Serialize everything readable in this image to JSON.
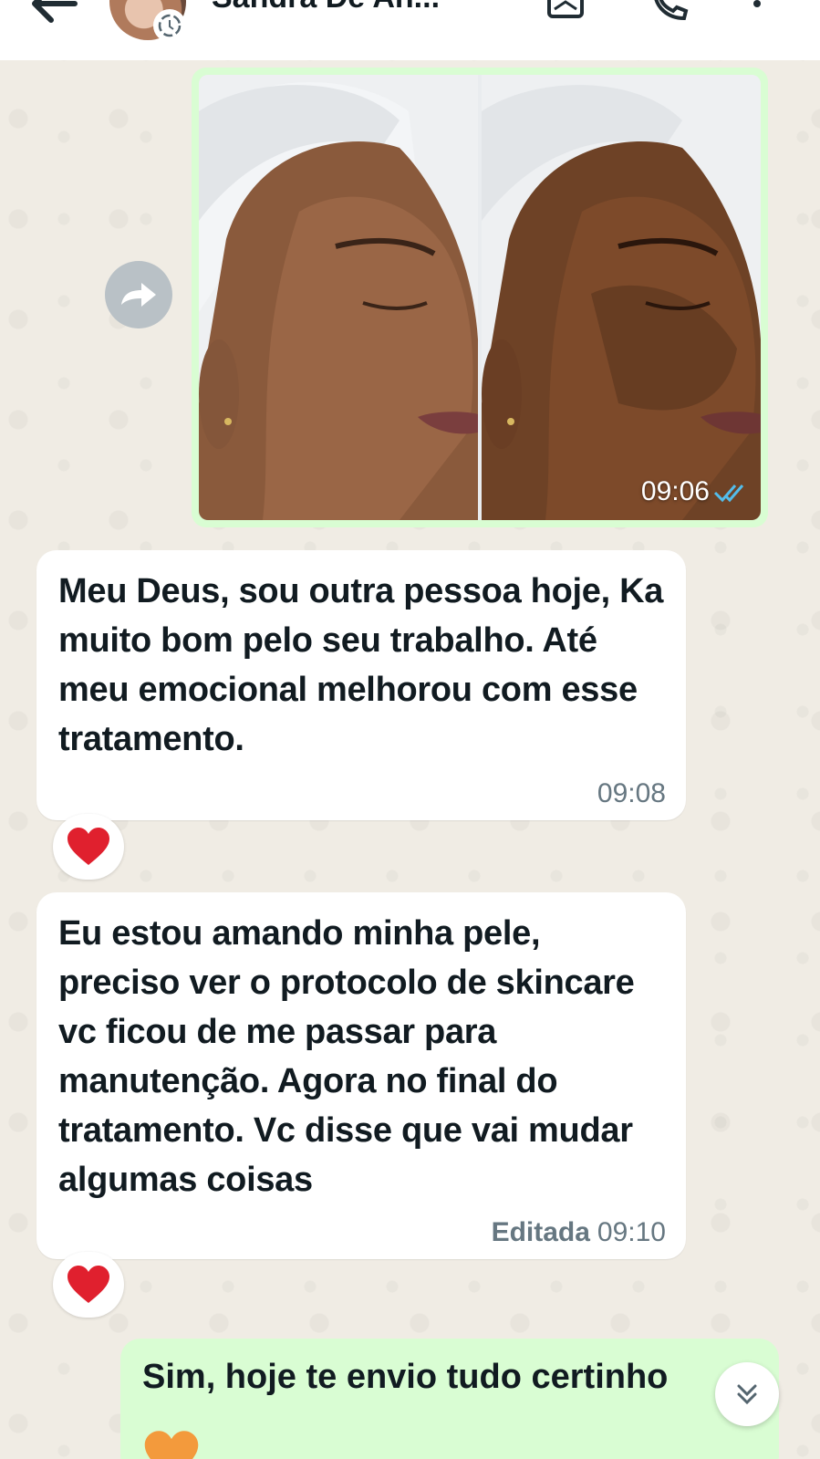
{
  "header": {
    "contact_name": "Sandra De An...",
    "icons": [
      "back-arrow-icon",
      "status-ring-icon",
      "video-call-icon",
      "phone-icon",
      "more-vert-icon"
    ]
  },
  "media_message": {
    "time": "09:06",
    "status": "double-check-read",
    "forward_icon": "forward-icon"
  },
  "messages": [
    {
      "direction": "incoming",
      "text": "Meu Deus, sou outra pessoa hoje, Ka muito bom pelo seu trabalho. Até meu emocional melhorou com esse tratamento.",
      "time": "09:08",
      "reaction": "❤️"
    },
    {
      "direction": "incoming",
      "text": "Eu estou amando minha pele, preciso ver o protocolo de skincare vc ficou de me passar para manutenção. Agora no final do tratamento. Vc disse que vai mudar algumas coisas",
      "edited_label": "Editada",
      "time": "09:10",
      "reaction": "❤️"
    },
    {
      "direction": "outgoing",
      "text": "Sim, hoje te envio tudo certinho",
      "emoji": "🧡"
    }
  ],
  "colors": {
    "outgoing_bubble": "#d9fdd3",
    "incoming_bubble": "#ffffff",
    "read_tick": "#53bdeb",
    "heart_red": "#e0202e",
    "heart_orange": "#f39a3c"
  },
  "scroll_icon": "double-chevron-down-icon"
}
